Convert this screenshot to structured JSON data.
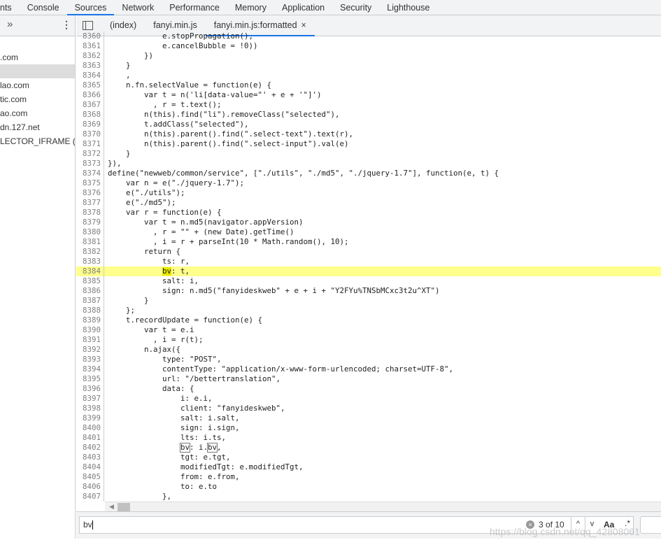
{
  "devtools_tabs": [
    {
      "label": "nts"
    },
    {
      "label": "Console"
    },
    {
      "label": "Sources",
      "active": true
    },
    {
      "label": "Network"
    },
    {
      "label": "Performance"
    },
    {
      "label": "Memory"
    },
    {
      "label": "Application"
    },
    {
      "label": "Security"
    },
    {
      "label": "Lighthouse"
    }
  ],
  "sidebar": {
    "more_icon": "»",
    "menu_icon": "⋮",
    "items": [
      {
        "label": ""
      },
      {
        "label": ".com"
      },
      {
        "label": "",
        "selected": true
      },
      {
        "label": "lao.com"
      },
      {
        "label": "tic.com"
      },
      {
        "label": "ao.com"
      },
      {
        "label": "dn.127.net"
      },
      {
        "label": "LECTOR_IFRAME (fan"
      }
    ]
  },
  "file_tabs": [
    {
      "label": "(index)"
    },
    {
      "label": "fanyi.min.js"
    },
    {
      "label": "fanyi.min.js:formatted",
      "active": true,
      "close": "×"
    }
  ],
  "editor": {
    "highlight_line": 8384,
    "lines": [
      {
        "n": "8360",
        "t": "            e.stopPropagation(),"
      },
      {
        "n": "8361",
        "t": "            e.cancelBubble = !0))"
      },
      {
        "n": "8362",
        "t": "        })"
      },
      {
        "n": "8363",
        "t": "    }"
      },
      {
        "n": "8364",
        "t": "    ,"
      },
      {
        "n": "8365",
        "t": "    n.fn.selectValue = function(e) {"
      },
      {
        "n": "8366",
        "t": "        var t = n('li[data-value=\"' + e + '\"]')"
      },
      {
        "n": "8367",
        "t": "          , r = t.text();"
      },
      {
        "n": "8368",
        "t": "        n(this).find(\"li\").removeClass(\"selected\"),"
      },
      {
        "n": "8369",
        "t": "        t.addClass(\"selected\"),"
      },
      {
        "n": "8370",
        "t": "        n(this).parent().find(\".select-text\").text(r),"
      },
      {
        "n": "8371",
        "t": "        n(this).parent().find(\".select-input\").val(e)"
      },
      {
        "n": "8372",
        "t": "    }"
      },
      {
        "n": "8373",
        "t": "}),"
      },
      {
        "n": "8374",
        "t": "define(\"newweb/common/service\", [\"./utils\", \"./md5\", \"./jquery-1.7\"], function(e, t) {"
      },
      {
        "n": "8375",
        "t": "    var n = e(\"./jquery-1.7\");"
      },
      {
        "n": "8376",
        "t": "    e(\"./utils\");"
      },
      {
        "n": "8377",
        "t": "    e(\"./md5\");"
      },
      {
        "n": "8378",
        "t": "    var r = function(e) {"
      },
      {
        "n": "8379",
        "t": "        var t = n.md5(navigator.appVersion)"
      },
      {
        "n": "8380",
        "t": "          , r = \"\" + (new Date).getTime()"
      },
      {
        "n": "8381",
        "t": "          , i = r + parseInt(10 * Math.random(), 10);"
      },
      {
        "n": "8382",
        "t": "        return {"
      },
      {
        "n": "8383",
        "t": "            ts: r,"
      },
      {
        "n": "8384",
        "t": "            bv: t,"
      },
      {
        "n": "8385",
        "t": "            salt: i,"
      },
      {
        "n": "8386",
        "t": "            sign: n.md5(\"fanyideskweb\" + e + i + \"Y2FYu%TNSbMCxc3t2u^XT\")"
      },
      {
        "n": "8387",
        "t": "        }"
      },
      {
        "n": "8388",
        "t": "    };"
      },
      {
        "n": "8389",
        "t": "    t.recordUpdate = function(e) {"
      },
      {
        "n": "8390",
        "t": "        var t = e.i"
      },
      {
        "n": "8391",
        "t": "          , i = r(t);"
      },
      {
        "n": "8392",
        "t": "        n.ajax({"
      },
      {
        "n": "8393",
        "t": "            type: \"POST\","
      },
      {
        "n": "8394",
        "t": "            contentType: \"application/x-www-form-urlencoded; charset=UTF-8\","
      },
      {
        "n": "8395",
        "t": "            url: \"/bettertranslation\","
      },
      {
        "n": "8396",
        "t": "            data: {"
      },
      {
        "n": "8397",
        "t": "                i: e.i,"
      },
      {
        "n": "8398",
        "t": "                client: \"fanyideskweb\","
      },
      {
        "n": "8399",
        "t": "                salt: i.salt,"
      },
      {
        "n": "8400",
        "t": "                sign: i.sign,"
      },
      {
        "n": "8401",
        "t": "                lts: i.ts,"
      },
      {
        "n": "8402",
        "t": "                bv: i.bv,"
      },
      {
        "n": "8403",
        "t": "                tgt: e.tgt,"
      },
      {
        "n": "8404",
        "t": "                modifiedTgt: e.modifiedTgt,"
      },
      {
        "n": "8405",
        "t": "                from: e.from,"
      },
      {
        "n": "8406",
        "t": "                to: e.to"
      },
      {
        "n": "8407",
        "t": "            },"
      },
      {
        "n": "8408",
        "t": ""
      }
    ]
  },
  "search": {
    "query": "bv",
    "match_count": "3 of 10",
    "prev_icon": "^",
    "next_icon": "v",
    "match_case": "Aa",
    "regex": ".*",
    "clear_icon": "×"
  },
  "watermark": "https://blog.csdn.net/qq_42808061"
}
